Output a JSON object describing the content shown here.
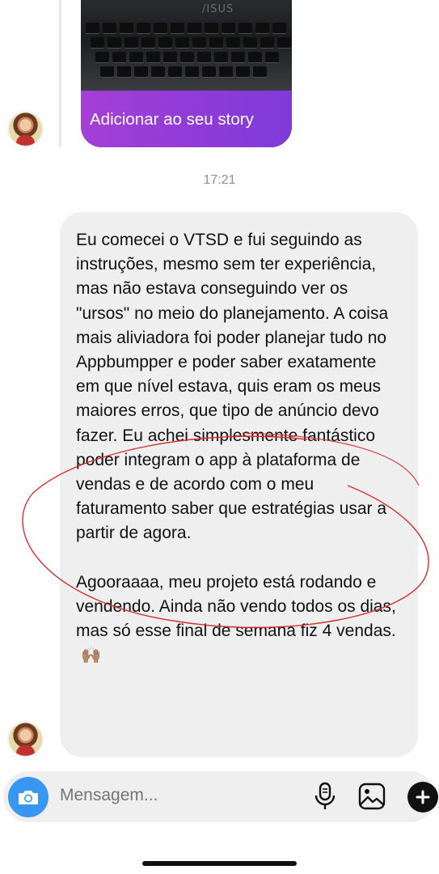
{
  "story": {
    "laptop_brand": "/ISUS",
    "button_label": "Adicionar ao seu story"
  },
  "timestamp": "17:21",
  "message": {
    "paragraph_1": "Eu comecei o VTSD e fui seguindo as instruções, mesmo sem ter experiência, mas não estava conseguindo ver os \"ursos\" no meio do planejamento. A coisa mais aliviadora foi poder planejar tudo no Appbumpper e poder saber exatamente em que nível estava, quis eram os meus maiores erros, que tipo de anúncio devo fazer. Eu achei simplesmente fantástico poder integram o app à plataforma de vendas e de acordo com o meu faturamento saber que estratégias usar a partir de agora.",
    "paragraph_2": "Agooraaaa, meu projeto está rodando e vendendo. Ainda não vendo todos os dias, mas só esse final de semana fiz 4 vendas.",
    "emoji": "🙌🏽"
  },
  "composer": {
    "placeholder": "Mensagem...",
    "icons": [
      "camera-icon",
      "microphone-icon",
      "gallery-icon",
      "plus-icon"
    ],
    "camera_color": "#3897f0"
  },
  "colors": {
    "story_gradient_start": "#a43fd6",
    "story_gradient_end": "#7e3bd9",
    "bubble_bg": "#efefef",
    "annotation_stroke": "#d32f2f"
  }
}
